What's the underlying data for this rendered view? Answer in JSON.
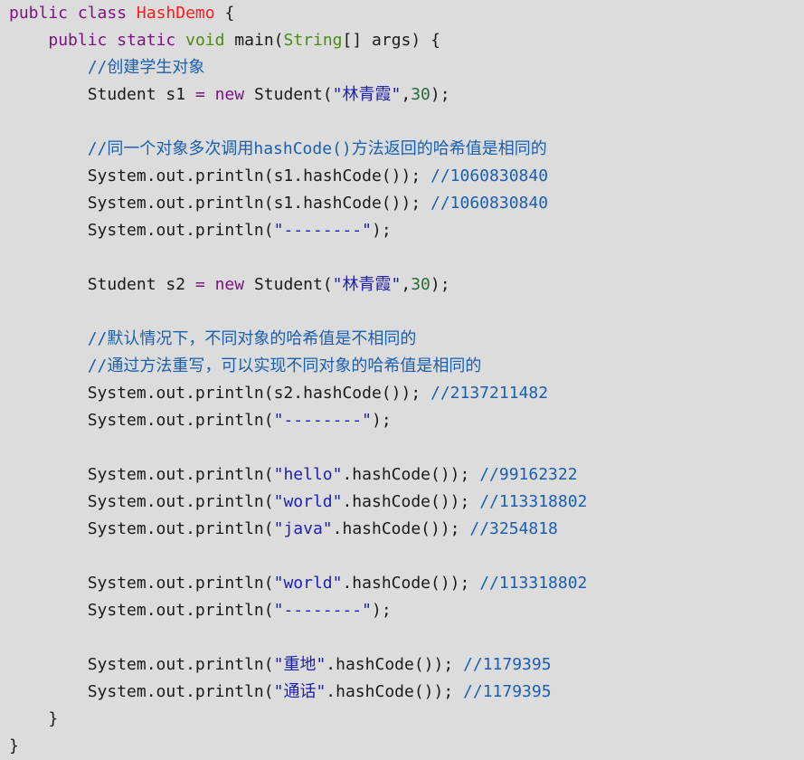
{
  "colors": {
    "background": "#dcdcdc",
    "keyword": "#7a1480",
    "class_name": "#ff1a1a",
    "type": "#4f8a10",
    "string": "#2020b0",
    "number": "#2a6b3a",
    "comment": "#1a5fb0"
  },
  "code_lines": [
    [
      [
        "kw",
        "public"
      ],
      [
        "plain",
        " "
      ],
      [
        "kw",
        "class"
      ],
      [
        "plain",
        " "
      ],
      [
        "cls",
        "HashDemo"
      ],
      [
        "plain",
        " {"
      ]
    ],
    [
      [
        "plain",
        "    "
      ],
      [
        "kw",
        "public"
      ],
      [
        "plain",
        " "
      ],
      [
        "kw",
        "static"
      ],
      [
        "plain",
        " "
      ],
      [
        "type",
        "void"
      ],
      [
        "plain",
        " main("
      ],
      [
        "type",
        "String"
      ],
      [
        "plain",
        "[] args) {"
      ]
    ],
    [
      [
        "plain",
        "        "
      ],
      [
        "com",
        "//创建学生对象"
      ]
    ],
    [
      [
        "plain",
        "        Student s1 "
      ],
      [
        "op",
        "="
      ],
      [
        "plain",
        " "
      ],
      [
        "kw",
        "new"
      ],
      [
        "plain",
        " Student("
      ],
      [
        "str",
        "\"林青霞\""
      ],
      [
        "plain",
        ","
      ],
      [
        "num",
        "30"
      ],
      [
        "plain",
        ");"
      ]
    ],
    [],
    [
      [
        "plain",
        "        "
      ],
      [
        "com",
        "//同一个对象多次调用hashCode()方法返回的哈希值是相同的"
      ]
    ],
    [
      [
        "plain",
        "        System.out.println(s1.hashCode()); "
      ],
      [
        "com",
        "//1060830840"
      ]
    ],
    [
      [
        "plain",
        "        System.out.println(s1.hashCode()); "
      ],
      [
        "com",
        "//1060830840"
      ]
    ],
    [
      [
        "plain",
        "        System.out.println("
      ],
      [
        "str",
        "\"--------\""
      ],
      [
        "plain",
        ");"
      ]
    ],
    [],
    [
      [
        "plain",
        "        Student s2 "
      ],
      [
        "op",
        "="
      ],
      [
        "plain",
        " "
      ],
      [
        "kw",
        "new"
      ],
      [
        "plain",
        " Student("
      ],
      [
        "str",
        "\"林青霞\""
      ],
      [
        "plain",
        ","
      ],
      [
        "num",
        "30"
      ],
      [
        "plain",
        ");"
      ]
    ],
    [],
    [
      [
        "plain",
        "        "
      ],
      [
        "com",
        "//默认情况下，不同对象的哈希值是不相同的"
      ]
    ],
    [
      [
        "plain",
        "        "
      ],
      [
        "com",
        "//通过方法重写，可以实现不同对象的哈希值是相同的"
      ]
    ],
    [
      [
        "plain",
        "        System.out.println(s2.hashCode()); "
      ],
      [
        "com",
        "//2137211482"
      ]
    ],
    [
      [
        "plain",
        "        System.out.println("
      ],
      [
        "str",
        "\"--------\""
      ],
      [
        "plain",
        ");"
      ]
    ],
    [],
    [
      [
        "plain",
        "        System.out.println("
      ],
      [
        "str",
        "\"hello\""
      ],
      [
        "plain",
        ".hashCode()); "
      ],
      [
        "com",
        "//99162322"
      ]
    ],
    [
      [
        "plain",
        "        System.out.println("
      ],
      [
        "str",
        "\"world\""
      ],
      [
        "plain",
        ".hashCode()); "
      ],
      [
        "com",
        "//113318802"
      ]
    ],
    [
      [
        "plain",
        "        System.out.println("
      ],
      [
        "str",
        "\"java\""
      ],
      [
        "plain",
        ".hashCode()); "
      ],
      [
        "com",
        "//3254818"
      ]
    ],
    [],
    [
      [
        "plain",
        "        System.out.println("
      ],
      [
        "str",
        "\"world\""
      ],
      [
        "plain",
        ".hashCode()); "
      ],
      [
        "com",
        "//113318802"
      ]
    ],
    [
      [
        "plain",
        "        System.out.println("
      ],
      [
        "str",
        "\"--------\""
      ],
      [
        "plain",
        ");"
      ]
    ],
    [],
    [
      [
        "plain",
        "        System.out.println("
      ],
      [
        "str",
        "\"重地\""
      ],
      [
        "plain",
        ".hashCode()); "
      ],
      [
        "com",
        "//1179395"
      ]
    ],
    [
      [
        "plain",
        "        System.out.println("
      ],
      [
        "str",
        "\"通话\""
      ],
      [
        "plain",
        ".hashCode()); "
      ],
      [
        "com",
        "//1179395"
      ]
    ],
    [
      [
        "plain",
        "    }"
      ]
    ],
    [
      [
        "plain",
        "}"
      ]
    ]
  ]
}
